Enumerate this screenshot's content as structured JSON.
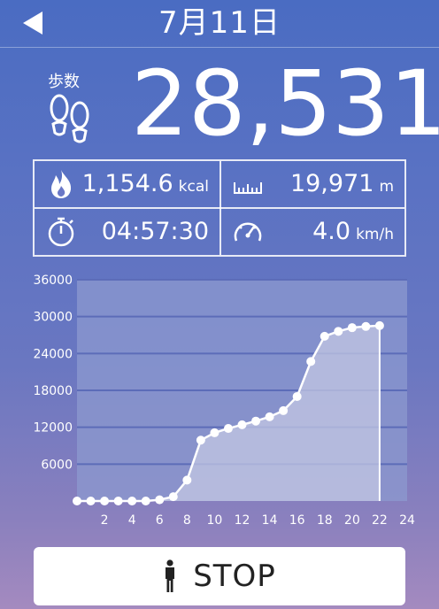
{
  "header": {
    "title": "7月11日"
  },
  "steps": {
    "label": "歩数",
    "value": "28,531"
  },
  "stats": {
    "calories": {
      "value": "1,154.6",
      "unit": "kcal"
    },
    "distance": {
      "value": "19,971",
      "unit": "m"
    },
    "duration": {
      "value": "04:57:30"
    },
    "speed": {
      "value": "4.0",
      "unit": "km/h"
    }
  },
  "chart_data": {
    "type": "area",
    "x": [
      0,
      1,
      2,
      3,
      4,
      5,
      6,
      7,
      8,
      9,
      10,
      11,
      12,
      13,
      14,
      15,
      16,
      17,
      18,
      19,
      20,
      21,
      22
    ],
    "values": [
      0,
      0,
      0,
      0,
      0,
      0,
      200,
      700,
      3400,
      9900,
      11100,
      11800,
      12400,
      13000,
      13700,
      14700,
      17000,
      22700,
      26800,
      27600,
      28200,
      28400,
      28531
    ],
    "xticks": [
      "2",
      "4",
      "6",
      "8",
      "10",
      "12",
      "14",
      "16",
      "18",
      "20",
      "22",
      "24"
    ],
    "yticks": [
      "36000",
      "30000",
      "24000",
      "18000",
      "12000",
      "6000"
    ],
    "xlim": [
      0,
      24
    ],
    "ylim": [
      0,
      36000
    ],
    "grid": true,
    "colors": {
      "line": "#ffffff",
      "plot_bg": "#8c99cf",
      "fill": "#c3c7e3",
      "grid": "#5c6cb8",
      "tick": "#ffffff"
    }
  },
  "stop": {
    "label": "STOP"
  }
}
